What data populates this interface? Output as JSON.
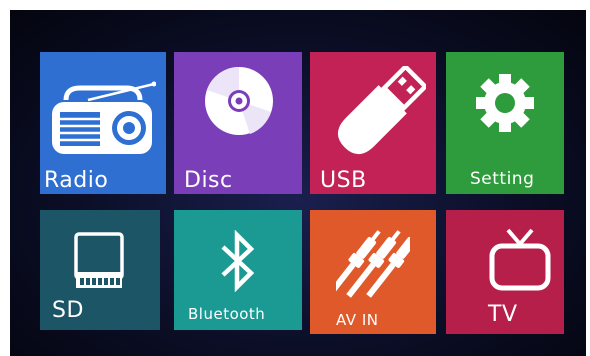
{
  "tiles": [
    {
      "id": "radio",
      "label": "Radio",
      "color": "#2e6fd1",
      "icon": "radio-icon"
    },
    {
      "id": "disc",
      "label": "Disc",
      "color": "#7a3fb8",
      "icon": "disc-icon"
    },
    {
      "id": "usb",
      "label": "USB",
      "color": "#c32257",
      "icon": "usb-icon"
    },
    {
      "id": "setting",
      "label": "Setting",
      "color": "#2e9c3c",
      "icon": "gear-icon"
    },
    {
      "id": "sd",
      "label": "SD",
      "color": "#1b5566",
      "icon": "sd-card-icon"
    },
    {
      "id": "bluetooth",
      "label": "Bluetooth",
      "color": "#1a9a93",
      "icon": "bluetooth-icon"
    },
    {
      "id": "avin",
      "label": "AV IN",
      "color": "#e0592a",
      "icon": "av-cable-icon"
    },
    {
      "id": "tv",
      "label": "TV",
      "color": "#b71f4b",
      "icon": "tv-icon"
    }
  ]
}
